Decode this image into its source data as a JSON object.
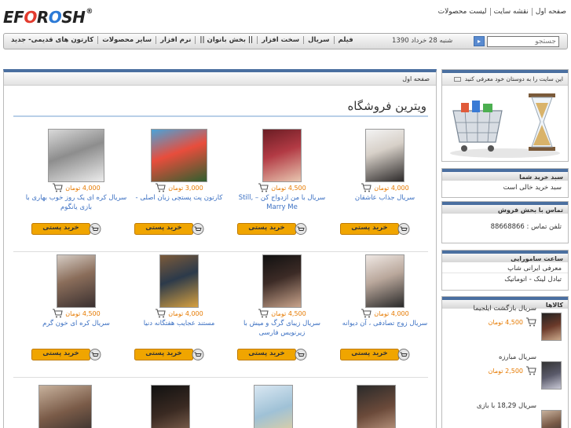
{
  "logo": {
    "main": "EF",
    "o1": "O",
    "r": "R",
    "o2": "O",
    "tail": "SH",
    "mark": "®"
  },
  "toplinks": [
    "صفحه اول",
    "نقشه سایت",
    "لیست محصولات"
  ],
  "nav": {
    "menu": [
      "فیلم",
      "سریال",
      "سخت افزار",
      "|| بخش بانوان ||",
      "نرم افزار",
      "سایر محصولات",
      "کارتون های قدیمی- جدید"
    ],
    "date": "شنبه 28 خرداد 1390",
    "search_button": "▸",
    "search_placeholder": "جستجو"
  },
  "breadcrumb": "صفحه اول",
  "store_title": "ویترین فروشگاه",
  "buy_label": "خرید پستی",
  "products": [
    {
      "name": "سریال جذاب عاشقان",
      "price": "4,000",
      "currency": "تومان"
    },
    {
      "name": "سریال با من ازدواج کن – Still, Marry Me",
      "price": "4,500",
      "currency": "تومان"
    },
    {
      "name": "کارتون پت پستچی زبان اصلی -",
      "price": "3,000",
      "currency": "تومان"
    },
    {
      "name": "سریال کره ای یک روز خوب بهاری با بازی یانگوم",
      "price": "4,000",
      "currency": "تومان"
    },
    {
      "name": "سریال زوج تصادفی ، آن دیوانه",
      "price": "4,000",
      "currency": "تومان"
    },
    {
      "name": "سریال زیبای گرگ و میش با زیرنویس فارسی",
      "price": "4,500",
      "currency": "تومان"
    },
    {
      "name": "مستند عجایب هفتگانه دنیا",
      "price": "4,000",
      "currency": "تومان"
    },
    {
      "name": "سریال کره ای خون گرم",
      "price": "4,500",
      "currency": "تومان"
    }
  ],
  "sidebar": {
    "recommend": "این سایت را به دوستان خود معرفی کنید",
    "cart_title": "سبد خرید شما",
    "cart_empty": "سبد خرید خالی است",
    "contact_title": "تماس با بخش فروش",
    "contact_phone": "تلفن تماس : 88668866",
    "hours_title": "ساعت سامورایی",
    "hours_links": [
      "معرفی ایرانی شاپ",
      "تبادل لینک - اتوماتیک"
    ],
    "goods_title": "کالاها",
    "goods": [
      {
        "name": "سریال بازگشت ایلجیما",
        "price": "4,500",
        "currency": "تومان"
      },
      {
        "name": "سریال مبارزه",
        "price": "2,500",
        "currency": "تومان"
      },
      {
        "name": "سریال 18,29 با بازی",
        "price": "",
        "currency": ""
      }
    ]
  },
  "colors": {
    "accent": "#4a6fa0",
    "price": "#e67a00",
    "link": "#3a6fc2",
    "buy": "#f0a500"
  }
}
